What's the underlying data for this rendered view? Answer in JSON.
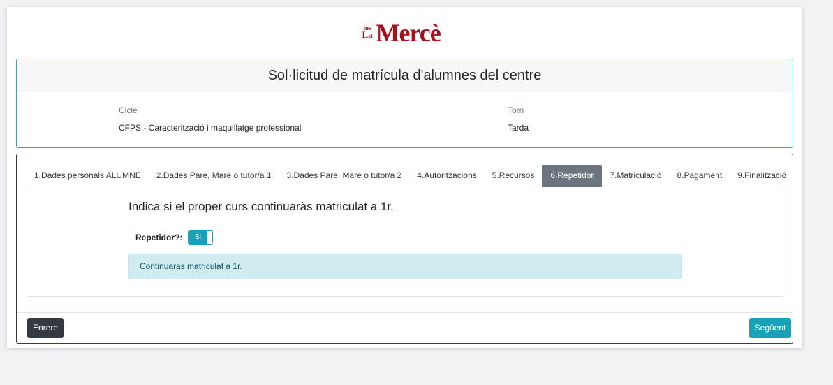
{
  "logo": {
    "line1": "ins",
    "line2": "La",
    "main": "Mercè"
  },
  "form": {
    "title": "Sol·licitud de matrícula d'alumnes del centre",
    "cicle_label": "Cicle",
    "cicle_value": "CFPS - Caracterització i maquillatge professional",
    "torn_label": "Torn",
    "torn_value": "Tarda"
  },
  "tabs": [
    {
      "label": "1.Dades personals ALUMNE",
      "active": false
    },
    {
      "label": "2.Dades Pare, Mare o tutor/a 1",
      "active": false
    },
    {
      "label": "3.Dades Pare, Mare o tutor/a 2",
      "active": false
    },
    {
      "label": "4.Autoritzacions",
      "active": false
    },
    {
      "label": "5.Recursos",
      "active": false
    },
    {
      "label": "6.Repetidor",
      "active": true
    },
    {
      "label": "7.Matriculació",
      "active": false
    },
    {
      "label": "8.Pagament",
      "active": false
    },
    {
      "label": "9.Finalització",
      "active": false
    }
  ],
  "panel": {
    "question": "Indica si el proper curs continuaràs matriculat a 1r.",
    "repetidor_label": "Repetidor?:",
    "toggle_value": "Si",
    "alert": "Continuaras matriculat a 1r."
  },
  "buttons": {
    "back": "Enrere",
    "next": "Següent"
  },
  "colors": {
    "accent": "#17a2b8",
    "dark": "#343a40",
    "tab_active": "#6c757d",
    "logo": "#a1121c"
  }
}
